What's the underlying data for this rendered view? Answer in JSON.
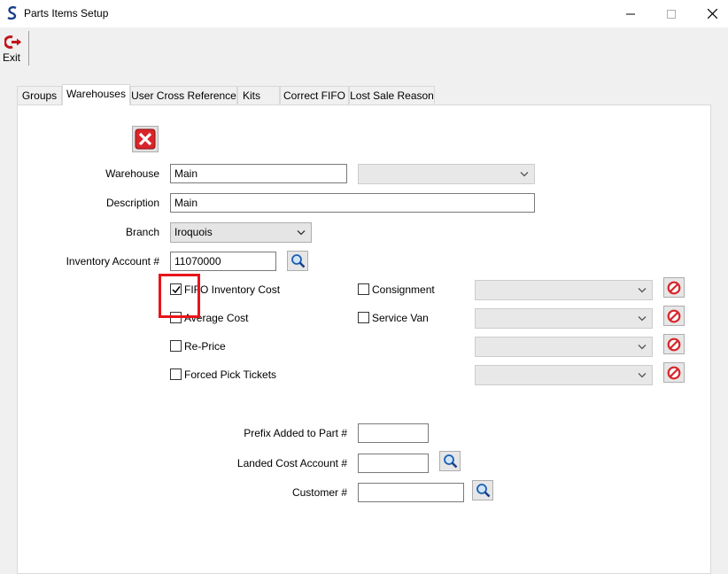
{
  "window": {
    "title": "Parts Items Setup",
    "icons": {
      "app": "s-logo-icon",
      "minimize": "minimize-icon",
      "maximize": "maximize-icon",
      "close": "close-icon"
    }
  },
  "toolbar": {
    "exit_label": "Exit",
    "exit_icon": "exit-arrow-icon"
  },
  "tabs": [
    {
      "label": "Groups",
      "active": false
    },
    {
      "label": "Warehouses",
      "active": true
    },
    {
      "label": "User Cross Reference",
      "active": false
    },
    {
      "label": "Kits",
      "active": false
    },
    {
      "label": "Correct FIFO",
      "active": false
    },
    {
      "label": "Lost Sale Reason",
      "active": false
    }
  ],
  "form": {
    "delete_icon": "delete-red-x-icon",
    "warehouse": {
      "label": "Warehouse",
      "value": "Main",
      "select_value": ""
    },
    "description": {
      "label": "Description",
      "value": "Main"
    },
    "branch": {
      "label": "Branch",
      "value": "Iroquois"
    },
    "inventory_account": {
      "label": "Inventory Account #",
      "value": "11070000"
    },
    "options": [
      {
        "label": "FIFO Inventory Cost",
        "checked": true
      },
      {
        "label": "Average Cost",
        "checked": false
      },
      {
        "label": "Re-Price",
        "checked": false
      },
      {
        "label": "Forced Pick Tickets",
        "checked": false
      }
    ],
    "right_options": [
      {
        "label": "Consignment",
        "checked": false
      },
      {
        "label": "Service Van",
        "checked": false
      }
    ],
    "prefix": {
      "label": "Prefix Added to Part #",
      "value": ""
    },
    "landed_cost": {
      "label": "Landed Cost Account #",
      "value": ""
    },
    "customer": {
      "label": "Customer #",
      "value": ""
    }
  },
  "colors": {
    "highlight": "#e8141b",
    "delete_red": "#d9252a",
    "accent_blue": "#1a5fb4"
  }
}
